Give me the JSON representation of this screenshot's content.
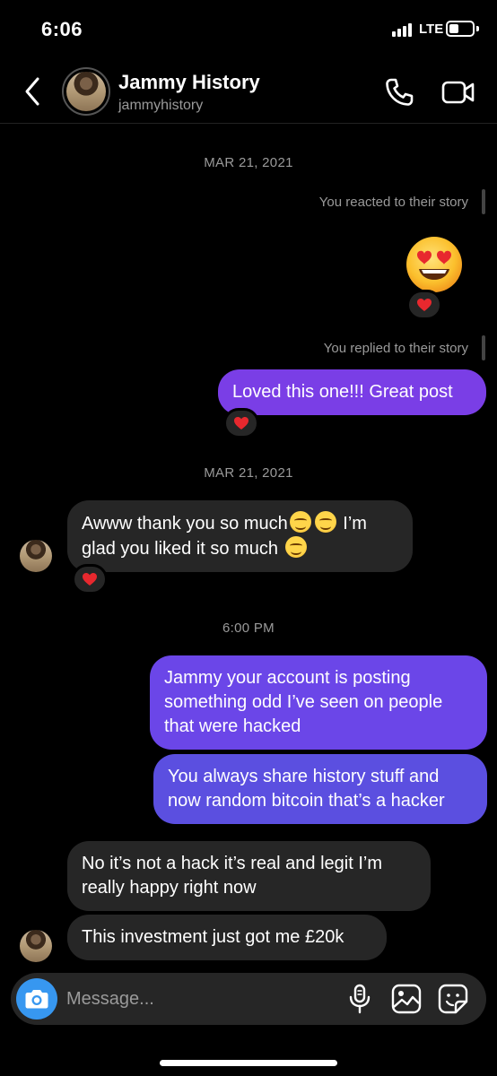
{
  "status_bar": {
    "time": "6:06",
    "network": "LTE"
  },
  "header": {
    "name": "Jammy History",
    "username": "jammyhistory"
  },
  "conversation": {
    "date_1": "MAR 21, 2021",
    "story_react_note": "You reacted to their story",
    "story_reply_note": "You replied to their story",
    "msg_loved": "Loved this one!!! Great post",
    "date_2": "MAR 21, 2021",
    "msg_thanks_line1": "Awww thank you so much",
    "msg_thanks_line1_end": " I’m",
    "msg_thanks_line2": "glad you liked it so much ",
    "time_sep": "6:00 PM",
    "msg_hacked": "Jammy your account is posting something odd I’ve seen on people that were hacked",
    "msg_bitcoin": "You always share history stuff and now random bitcoin that’s a hacker",
    "msg_not_hack": "No it’s not a hack it’s real and legit I’m really happy right now",
    "msg_investment": "This investment just got me £20k"
  },
  "composer": {
    "placeholder": "Message..."
  },
  "colors": {
    "bubble_purple": "#7a3ee6",
    "bubble_indigo": "#5b4fe0",
    "bubble_incoming": "#262626",
    "accent_blue": "#3797f0"
  },
  "icons": [
    "back-icon",
    "phone-icon",
    "video-camera-icon",
    "heart-icon",
    "heart-eyes-emoji",
    "smile-emoji",
    "camera-icon",
    "microphone-icon",
    "gallery-icon",
    "sticker-icon"
  ]
}
